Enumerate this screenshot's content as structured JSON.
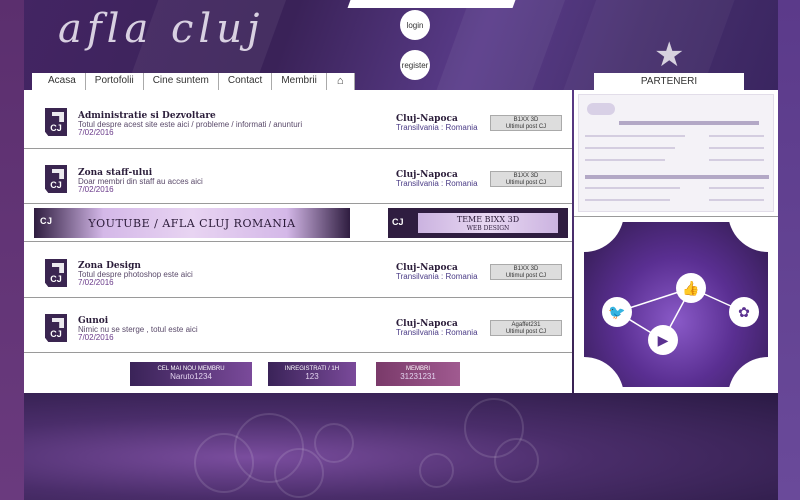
{
  "header": {
    "logo_text": "afla cluj",
    "login_label": "login",
    "register_label": "register",
    "nav": [
      "Acasa",
      "Portofolii",
      "Cine suntem",
      "Contact",
      "Membrii"
    ],
    "partners_label": "PARTENERI"
  },
  "forums": [
    {
      "title": "Administratie si Dezvoltare",
      "desc": "Totul despre acest site este aici / probleme / informati / anunturi",
      "date": "7/02/2016",
      "city": "Cluj-Napoca",
      "region": "Transilvania : Romania",
      "last_user": "B1XX 3D",
      "last_caption": "Ultimul post CJ"
    },
    {
      "title": "Zona staff-ului",
      "desc": "Doar membri din staff au acces aici",
      "date": "7/02/2016",
      "city": "Cluj-Napoca",
      "region": "Transilvania : Romania",
      "last_user": "B1XX 3D",
      "last_caption": "Ultimul post CJ"
    },
    {
      "title": "Zona Design",
      "desc": "Totul despre photoshop este aici",
      "date": "7/02/2016",
      "city": "Cluj-Napoca",
      "region": "Transilvania : Romania",
      "last_user": "B1XX 3D",
      "last_caption": "Ultimul post CJ"
    },
    {
      "title": "Gunoi",
      "desc": "Nimic nu se sterge , totul este aici",
      "date": "7/02/2016",
      "city": "Cluj-Napoca",
      "region": "Transilvania : Romania",
      "last_user": "Agaffet231",
      "last_caption": "Ultimul post CJ"
    }
  ],
  "cj_label": "CJ",
  "banners": {
    "youtube": "YOUTUBE / AFLA CLUJ ROMANIA",
    "teme_title": "TEME BIXX 3D",
    "teme_sub": "WEB DESIGN"
  },
  "stats": [
    {
      "label": "CEL MAI NOU MEMBRU",
      "value": "Naruto1234"
    },
    {
      "label": "INREGISTRATI / 1H",
      "value": "123"
    },
    {
      "label": "MEMBRI",
      "value": "31231231"
    }
  ],
  "icons": {
    "home": "home-icon",
    "star": "star-icon",
    "twitter": "twitter-icon",
    "facebook_like": "thumbs-up-icon",
    "youtube": "play-icon",
    "pinterest": "pinterest-icon"
  },
  "colors": {
    "accent": "#4a2d6a",
    "dark": "#2f1d40",
    "text": "#2b1d3a"
  }
}
